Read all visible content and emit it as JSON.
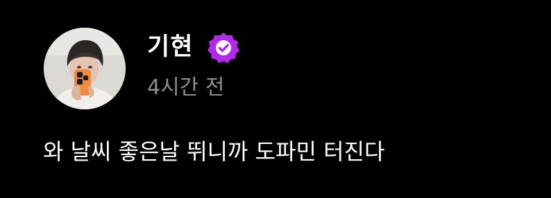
{
  "post": {
    "author": {
      "name": "기현",
      "verified": true,
      "badge_icon": "verified-badge-icon",
      "badge_color": "#b12ae8"
    },
    "timestamp": "4시간 전",
    "text": "와 날씨 좋은날 뛰니까 도파민 터진다"
  },
  "colors": {
    "background": "#000000",
    "primary_text": "#ffffff",
    "secondary_text": "#8e8e93"
  }
}
